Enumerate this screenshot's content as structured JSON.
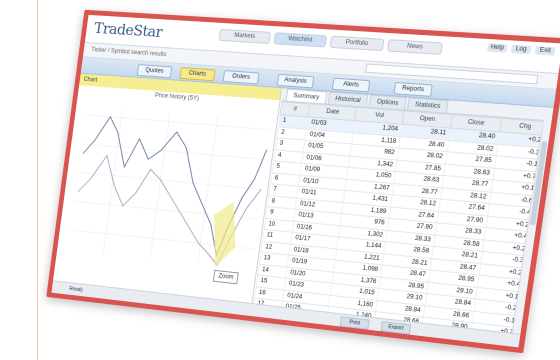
{
  "app": {
    "logo": "TradeStar"
  },
  "top_tabs": [
    "Markets",
    "Watchlist",
    "Portfolio",
    "News"
  ],
  "top_right": [
    "Help",
    "Log",
    "Exit"
  ],
  "subbar": {
    "label": "Ticker / Symbol search results"
  },
  "nav": [
    {
      "label": "Quotes",
      "highlight": false
    },
    {
      "label": "Charts",
      "highlight": true
    },
    {
      "label": "Orders",
      "highlight": false
    },
    {
      "label": "Analysis",
      "highlight": false
    },
    {
      "label": "Alerts",
      "highlight": false
    },
    {
      "label": "Reports",
      "highlight": false
    }
  ],
  "chart_panel": {
    "tab": "Chart",
    "title": "Price history (5Y)"
  },
  "right_tabs": [
    "Summary",
    "Historical",
    "Options",
    "Statistics"
  ],
  "table": {
    "columns": [
      "#",
      "Date",
      "Vol",
      "Open",
      "Close",
      "Chg"
    ],
    "rows": [
      [
        "1",
        "01/03",
        "1,204",
        "28.11",
        "28.40",
        "+0.29"
      ],
      [
        "2",
        "01/04",
        "1,118",
        "28.40",
        "28.02",
        "-0.38"
      ],
      [
        "3",
        "01/05",
        "982",
        "28.02",
        "27.85",
        "-0.17"
      ],
      [
        "4",
        "01/06",
        "1,342",
        "27.85",
        "28.63",
        "+0.78"
      ],
      [
        "5",
        "01/09",
        "1,050",
        "28.63",
        "28.77",
        "+0.14"
      ],
      [
        "6",
        "01/10",
        "1,267",
        "28.77",
        "28.12",
        "-0.65"
      ],
      [
        "7",
        "01/11",
        "1,431",
        "28.12",
        "27.64",
        "-0.48"
      ],
      [
        "8",
        "01/12",
        "1,189",
        "27.64",
        "27.90",
        "+0.26"
      ],
      [
        "9",
        "01/13",
        "976",
        "27.90",
        "28.33",
        "+0.43"
      ],
      [
        "10",
        "01/16",
        "1,302",
        "28.33",
        "28.58",
        "+0.25"
      ],
      [
        "11",
        "01/17",
        "1,144",
        "28.58",
        "28.21",
        "-0.37"
      ],
      [
        "12",
        "01/18",
        "1,221",
        "28.21",
        "28.47",
        "+0.26"
      ],
      [
        "13",
        "01/19",
        "1,098",
        "28.47",
        "28.95",
        "+0.48"
      ],
      [
        "14",
        "01/20",
        "1,376",
        "28.95",
        "29.10",
        "+0.15"
      ],
      [
        "15",
        "01/23",
        "1,015",
        "29.10",
        "28.84",
        "-0.26"
      ],
      [
        "16",
        "01/24",
        "1,160",
        "28.84",
        "28.66",
        "-0.18"
      ],
      [
        "17",
        "01/25",
        "1,240",
        "28.66",
        "28.90",
        "+0.24"
      ]
    ]
  },
  "status": {
    "left": "Ready",
    "btn1": "Print",
    "btn2": "Export"
  },
  "chip": "Zoom"
}
